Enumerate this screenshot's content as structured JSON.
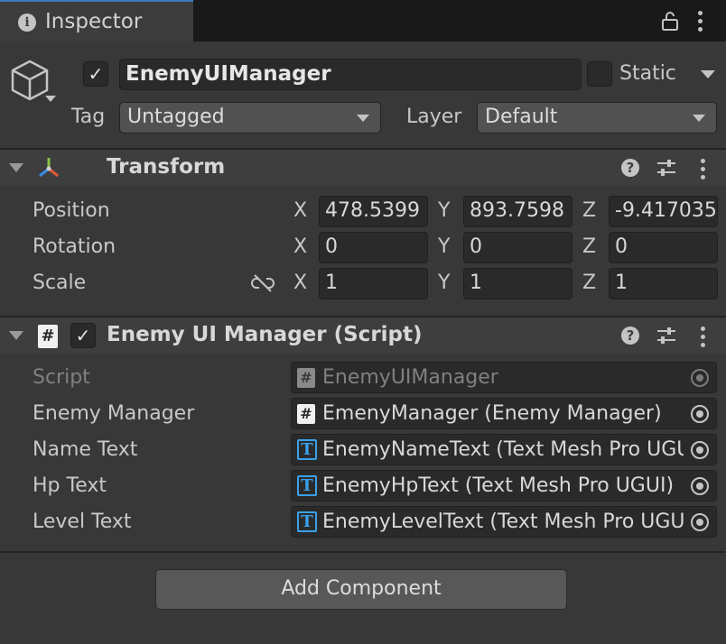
{
  "window": {
    "tab_label": "Inspector"
  },
  "header": {
    "active": true,
    "object_name": "EnemyUIManager",
    "static_label": "Static",
    "static": false,
    "tag_label": "Tag",
    "tag_value": "Untagged",
    "layer_label": "Layer",
    "layer_value": "Default"
  },
  "transform": {
    "title": "Transform",
    "rows": [
      {
        "label": "Position",
        "x": "478.5399",
        "y": "893.7598",
        "z": "-9.417035"
      },
      {
        "label": "Rotation",
        "x": "0",
        "y": "0",
        "z": "0"
      },
      {
        "label": "Scale",
        "x": "1",
        "y": "1",
        "z": "1"
      }
    ],
    "axis": {
      "x": "X",
      "y": "Y",
      "z": "Z"
    }
  },
  "script_component": {
    "title": "Enemy UI Manager (Script)",
    "enabled": true,
    "fields": [
      {
        "label": "Script",
        "value": "EnemyUIManager",
        "icon": "script-icon"
      },
      {
        "label": "Enemy Manager",
        "value": "EmenyManager (Enemy Manager)",
        "icon": "script-icon"
      },
      {
        "label": "Name Text",
        "value": "EnemyNameText (Text Mesh Pro UGUI)",
        "icon": "textmeshpro-icon"
      },
      {
        "label": "Hp Text",
        "value": "EnemyHpText (Text Mesh Pro UGUI)",
        "icon": "textmeshpro-icon"
      },
      {
        "label": "Level Text",
        "value": "EnemyLevelText (Text Mesh Pro UGUI)",
        "icon": "textmeshpro-icon"
      }
    ]
  },
  "add_component_label": "Add Component",
  "colors": {
    "accent_tab": "#3a79bb",
    "tmp_icon": "#3aa0e8",
    "background": "#383838"
  }
}
